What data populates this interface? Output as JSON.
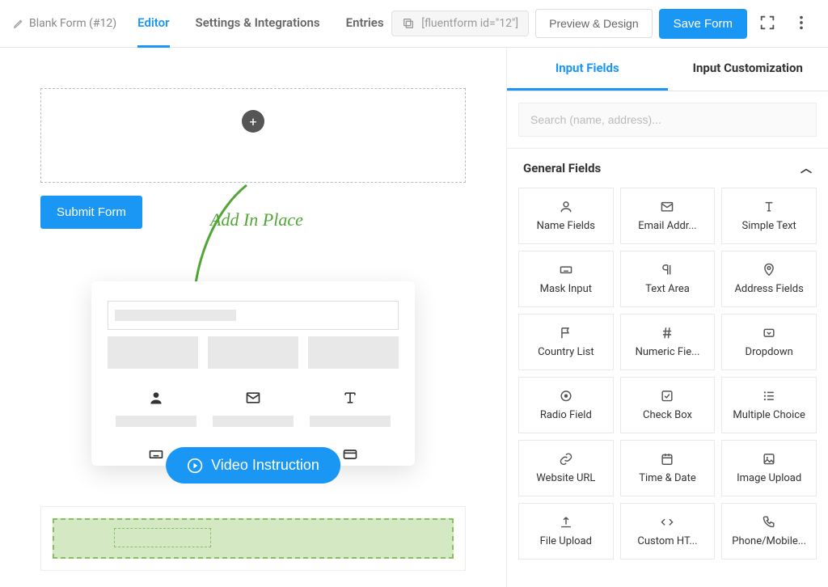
{
  "header": {
    "form_title": "Blank Form (#12)",
    "tabs": [
      "Editor",
      "Settings & Integrations",
      "Entries"
    ],
    "active_tab": 0,
    "shortcode": "[fluentform id=\"12\"]",
    "preview_btn": "Preview & Design",
    "save_btn": "Save Form"
  },
  "canvas": {
    "submit_label": "Submit Form",
    "hint": "Add In Place",
    "video_btn": "Video Instruction"
  },
  "sidebar": {
    "tabs": [
      "Input Fields",
      "Input Customization"
    ],
    "active_tab": 0,
    "search_placeholder": "Search (name, address)...",
    "section_title": "General Fields",
    "fields": [
      {
        "icon": "user",
        "label": "Name Fields"
      },
      {
        "icon": "mail",
        "label": "Email Addr..."
      },
      {
        "icon": "text",
        "label": "Simple Text"
      },
      {
        "icon": "keyboard",
        "label": "Mask Input"
      },
      {
        "icon": "para",
        "label": "Text Area"
      },
      {
        "icon": "pin",
        "label": "Address Fields"
      },
      {
        "icon": "flag",
        "label": "Country List"
      },
      {
        "icon": "hash",
        "label": "Numeric Fie..."
      },
      {
        "icon": "caret",
        "label": "Dropdown"
      },
      {
        "icon": "radio",
        "label": "Radio Field"
      },
      {
        "icon": "check",
        "label": "Check Box"
      },
      {
        "icon": "list",
        "label": "Multiple Choice"
      },
      {
        "icon": "link",
        "label": "Website URL"
      },
      {
        "icon": "cal",
        "label": "Time & Date"
      },
      {
        "icon": "img",
        "label": "Image Upload"
      },
      {
        "icon": "upload",
        "label": "File Upload"
      },
      {
        "icon": "code",
        "label": "Custom HT..."
      },
      {
        "icon": "phone",
        "label": "Phone/Mobile..."
      }
    ]
  }
}
